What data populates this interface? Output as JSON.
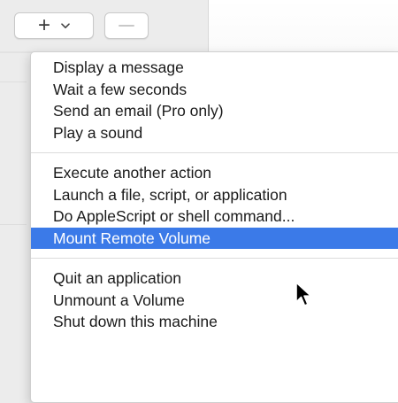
{
  "toolbar": {
    "add_icon": "plus-icon",
    "add_glyph": "+",
    "dropdown_icon": "chevron-down-icon",
    "remove_icon": "minus-icon"
  },
  "menu": {
    "groups": [
      [
        "Display a message",
        "Wait a few seconds",
        "Send an email (Pro only)",
        "Play a sound"
      ],
      [
        "Execute another action",
        "Launch a file, script, or application",
        "Do AppleScript or shell command...",
        "Mount Remote Volume"
      ],
      [
        "Quit an application",
        "Unmount a Volume",
        "Shut down this machine"
      ]
    ],
    "selected": "Mount Remote Volume",
    "selected_color": "#3b7ae8"
  }
}
